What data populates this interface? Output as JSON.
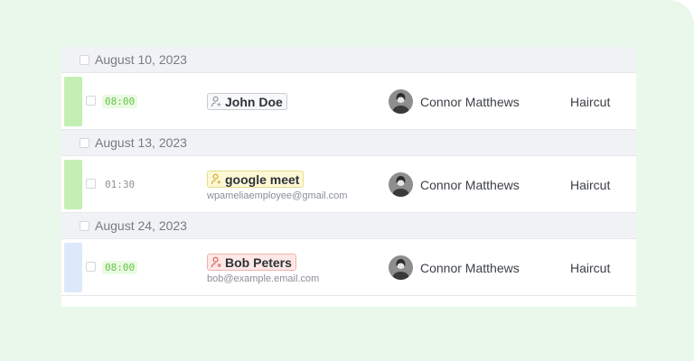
{
  "groups": [
    {
      "date": "August 10, 2023",
      "appointment": {
        "status_color": "#c4efb2",
        "time": "08:00",
        "time_style": "green",
        "customer": {
          "name": "John Doe",
          "email": "",
          "badge": "default",
          "icon": "person-icon"
        },
        "employee": {
          "name": "Connor Matthews"
        },
        "service": "Haircut"
      }
    },
    {
      "date": "August 13, 2023",
      "appointment": {
        "status_color": "#c4efb2",
        "time": "01:30",
        "time_style": "plain",
        "customer": {
          "name": "google meet",
          "email": "wpameliaemployee@gmail.com",
          "badge": "yellow",
          "icon": "person-icon"
        },
        "employee": {
          "name": "Connor Matthews"
        },
        "service": "Haircut"
      }
    },
    {
      "date": "August 24, 2023",
      "appointment": {
        "status_color": "#dde9fb",
        "time": "08:00",
        "time_style": "green",
        "customer": {
          "name": "Bob Peters",
          "email": "bob@example.email.com",
          "badge": "red",
          "icon": "person-x-icon"
        },
        "employee": {
          "name": "Connor Matthews"
        },
        "service": "Haircut"
      }
    }
  ]
}
